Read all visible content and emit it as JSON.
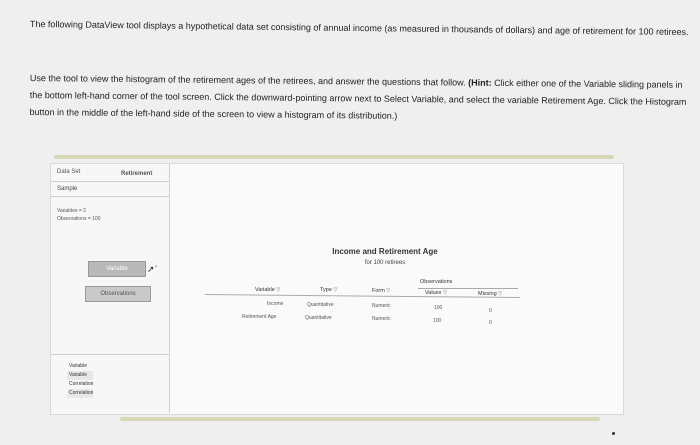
{
  "instructions": {
    "p1": "The following DataView tool displays a hypothetical data set consisting of annual income (as measured in thousands of dollars) and age of retirement for 100 retirees.",
    "p2_start": "Use the tool to view the histogram of the retirement ages of the retirees, and answer the questions that follow. ",
    "p2_hint": "(Hint:",
    "p2_end": " Click either one of the Variable sliding panels in the bottom left-hand corner of the tool screen. Click the downward-pointing arrow next to Select Variable, and select the variable Retirement Age. Click the Histogram button in the middle of the left-hand side of the screen to view a histogram of its distribution.)"
  },
  "sidebar": {
    "tab_dataset": "Data Set",
    "tab_retirement": "Retirement",
    "sample": "Sample",
    "variables_line": "Variables = 2",
    "observations_line": "Observations = 100",
    "variable_button": "Variable",
    "observations_button": "Observations",
    "list": [
      "Variable",
      "Variable",
      "Correlation",
      "Correlation"
    ]
  },
  "table": {
    "title": "Income and Retirement Age",
    "subtitle": "for 100 retirees",
    "group_header": "Observations",
    "headers": [
      "Variable",
      "Type",
      "Form",
      "Values",
      "Missing"
    ],
    "rows": [
      [
        "Income",
        "Quantitative",
        "Numeric",
        "100",
        "0"
      ],
      [
        "Retirement Age",
        "Quantitative",
        "Numeric",
        "100",
        "0"
      ]
    ]
  }
}
